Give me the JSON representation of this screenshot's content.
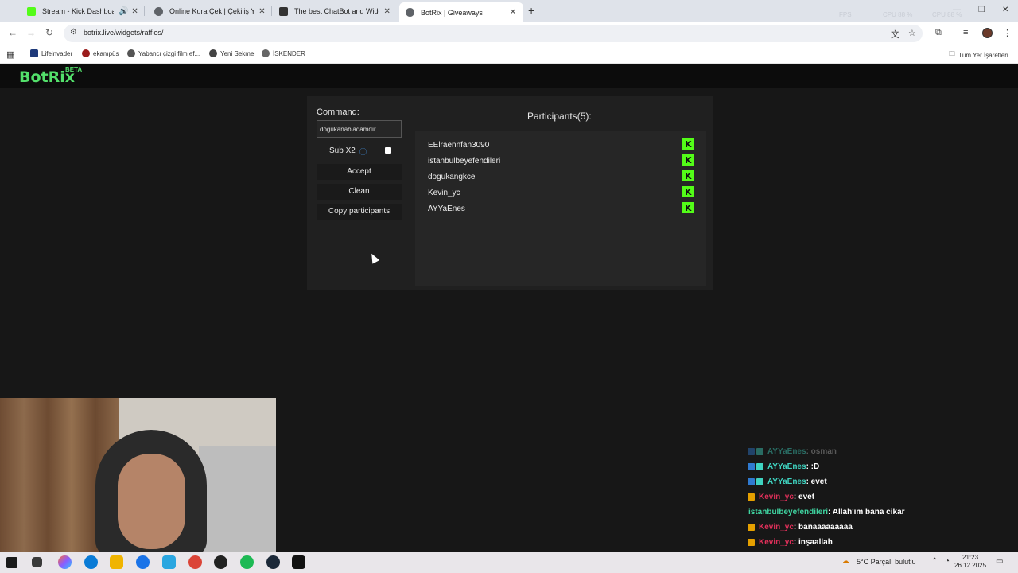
{
  "browser": {
    "tabs": [
      {
        "label": "Stream - Kick Dashboard",
        "favicon_color": "#53fc18"
      },
      {
        "label": "Online Kura Çek | Çekiliş Yap",
        "favicon_color": "#5f6368"
      },
      {
        "label": "The best ChatBot and Widgets",
        "favicon_color": "#333333"
      },
      {
        "label": "BotRix | Giveaways",
        "favicon_color": "#5f6368"
      }
    ],
    "url": "botrix.live/widgets/raffles/",
    "bookmarks": [
      {
        "label": "Lifeinvader"
      },
      {
        "label": "ekampüs"
      },
      {
        "label": "Yabancı çizgi film ef..."
      },
      {
        "label": "Yeni Sekme"
      },
      {
        "label": "İSKENDER"
      }
    ],
    "all_bookmarks": "Tüm Yer İşaretleri",
    "hud": {
      "fps": "FPS",
      "cpu1": "CPU 88 %",
      "cpu2": "CPU 88 %"
    }
  },
  "page": {
    "logo": "BotRix",
    "logo_badge": "BETA",
    "accent_color": "#53e06b",
    "command_label": "Command:",
    "command_value": "dogukanabiadamdır",
    "sub_x2_label": "Sub X2",
    "buttons": {
      "accept": "Accept",
      "clean": "Clean",
      "copy": "Copy participants"
    },
    "participants_title": "Participants(5):",
    "participants": [
      {
        "name": "EElraennfan3090"
      },
      {
        "name": "istanbulbeyefendileri"
      },
      {
        "name": "dogukangkce"
      },
      {
        "name": "Kevin_yc"
      },
      {
        "name": "AYYaEnes"
      }
    ]
  },
  "chat": [
    {
      "user": "AYYaEnes",
      "text": ": osman",
      "color": "#2a8a7a",
      "faded": true
    },
    {
      "user": "AYYaEnes",
      "text": ": :D",
      "color": "#3fd3c0",
      "faded": false
    },
    {
      "user": "AYYaEnes",
      "text": ": evet",
      "color": "#3fd3c0",
      "faded": false
    },
    {
      "user": "Kevin_yc",
      "text": ": evet",
      "color": "#e0305a",
      "faded": false
    },
    {
      "user": "istanbulbeyefendileri",
      "text": ": Allah'ım bana cikar",
      "color": "#3fd3a0",
      "faded": false
    },
    {
      "user": "Kevin_yc",
      "text": ": banaaaaaaaaa",
      "color": "#e0305a",
      "faded": false
    },
    {
      "user": "Kevin_yc",
      "text": ": inşaallah",
      "color": "#e0305a",
      "faded": false
    }
  ],
  "taskbar": {
    "weather": "5°C  Parçalı bulutlu",
    "time": "21:23",
    "date": "26.12.2025"
  }
}
